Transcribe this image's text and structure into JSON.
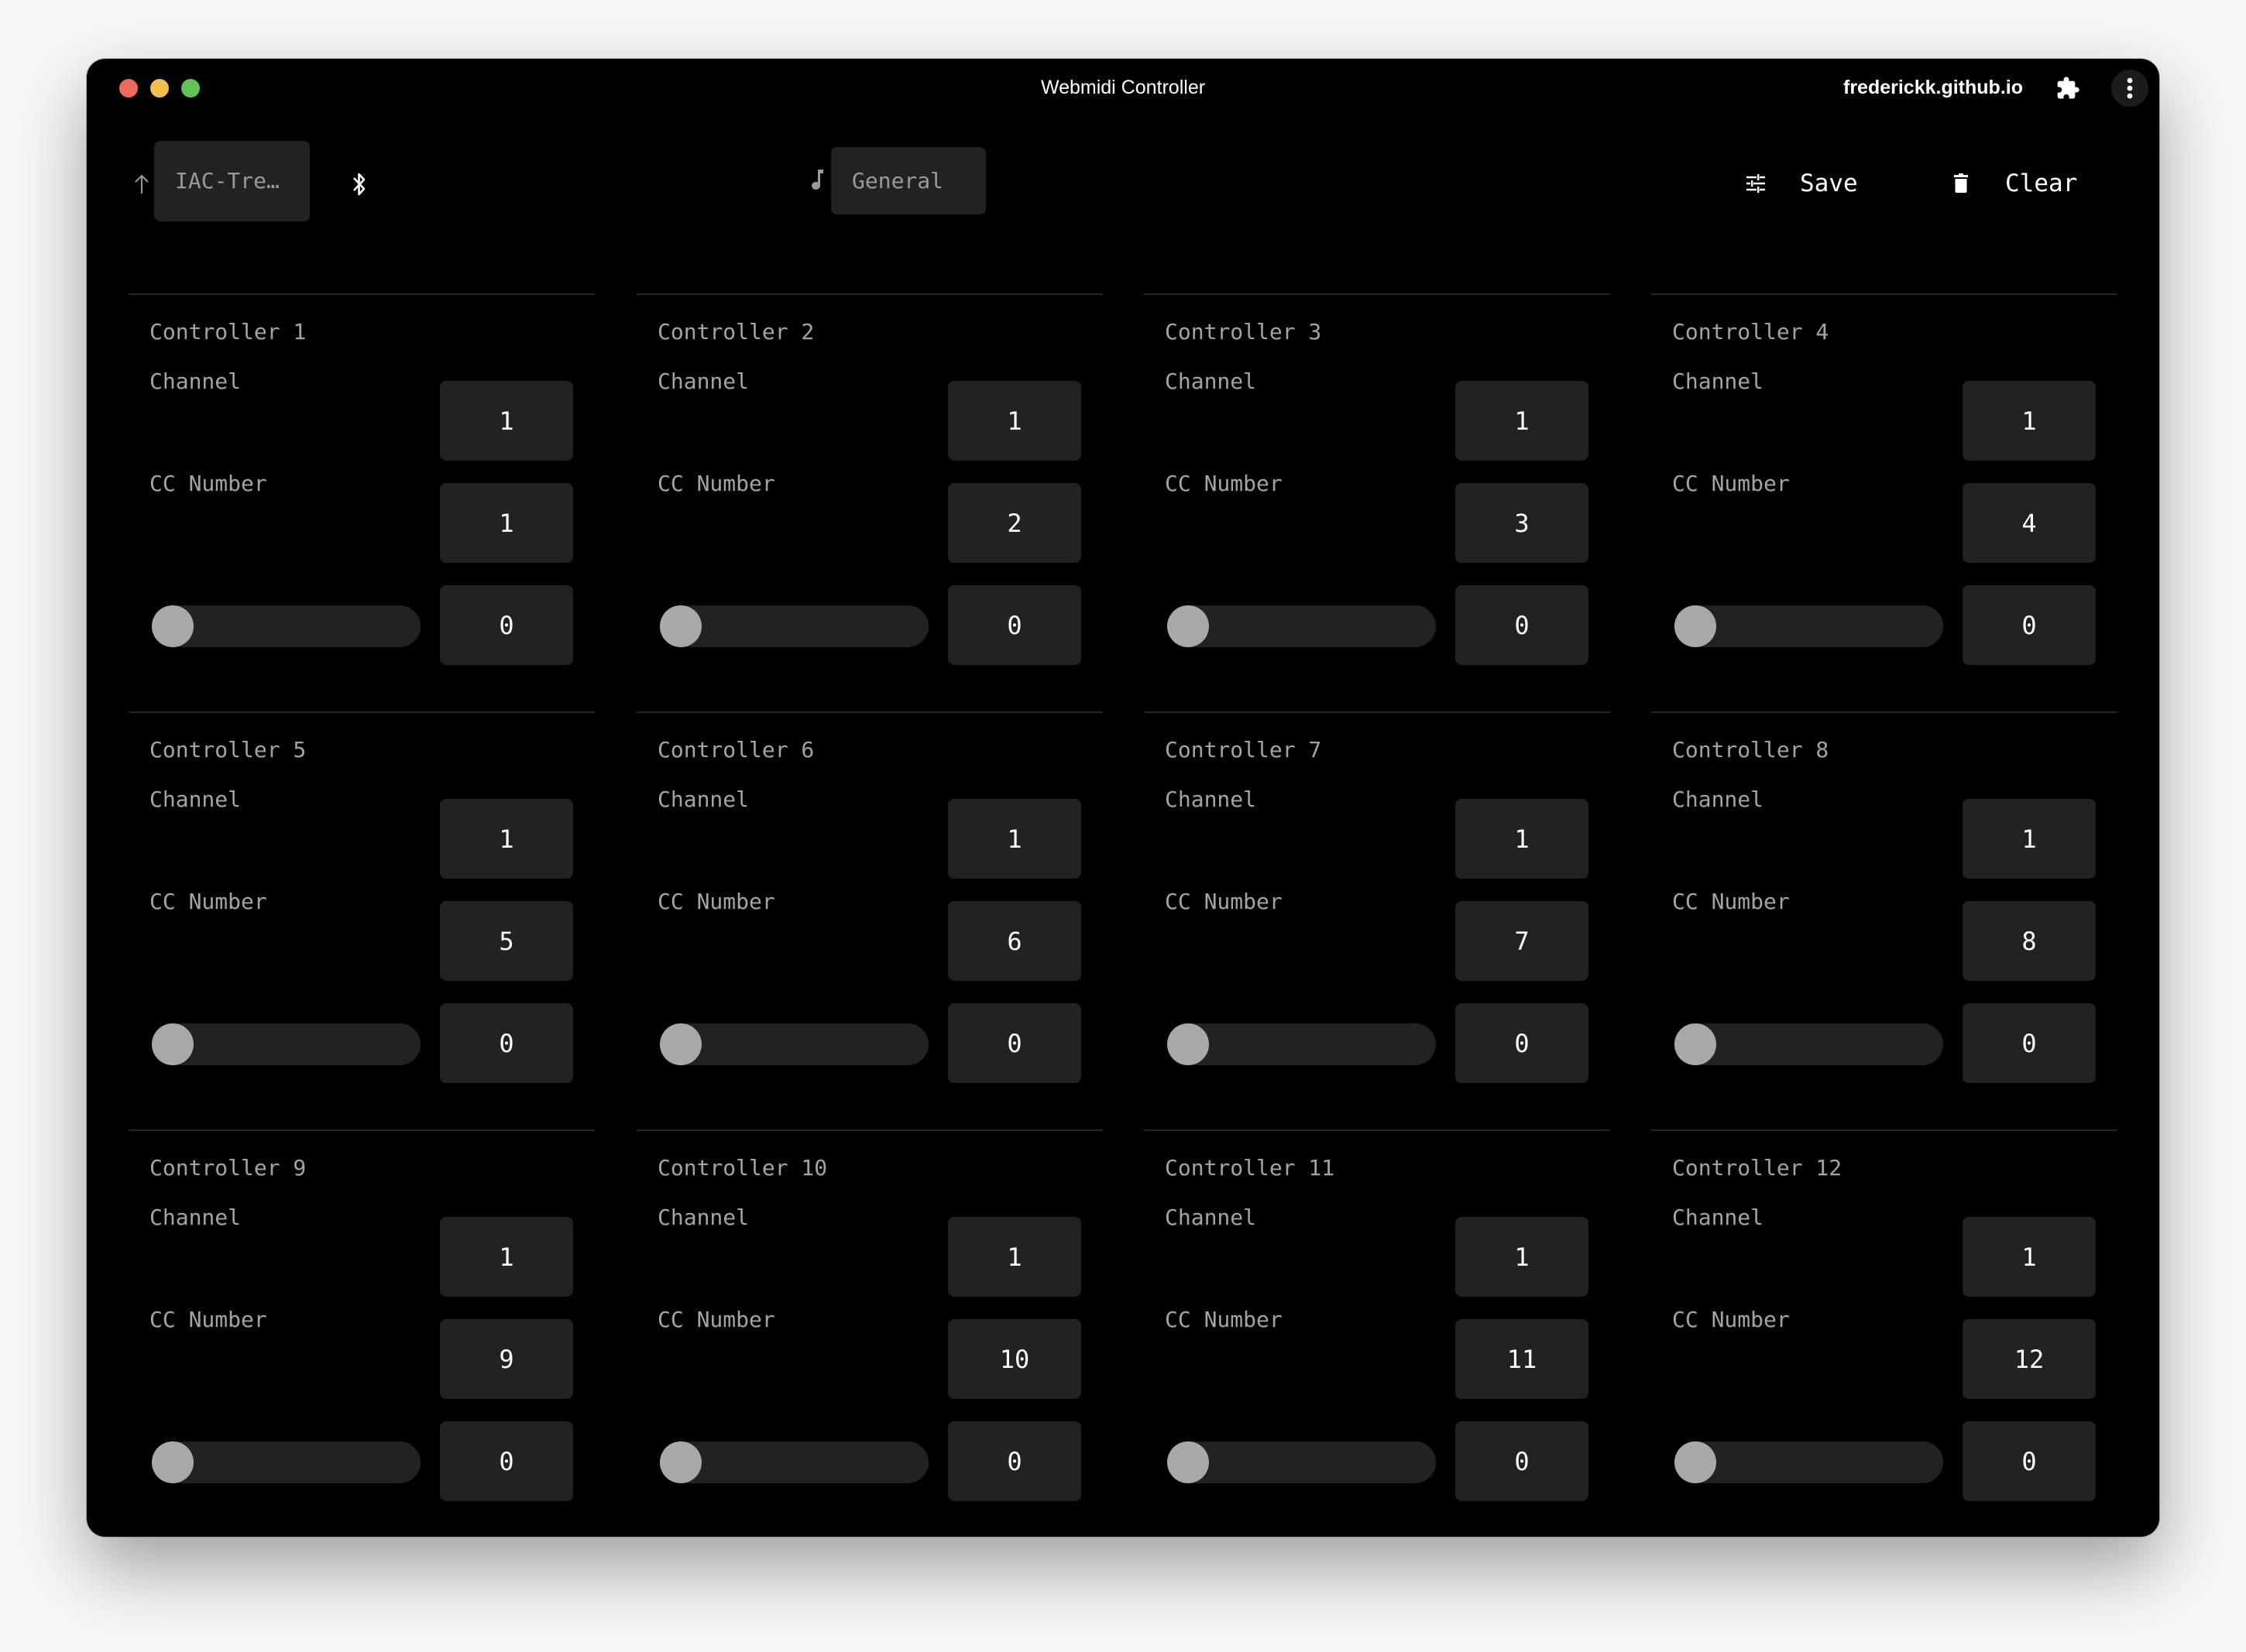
{
  "window": {
    "title": "Webmidi Controller",
    "domain": "frederickk.github.io",
    "traffic_lights": {
      "close": "#ee6a5f",
      "minimize": "#f5bf4f",
      "zoom": "#61c454"
    },
    "icons": {
      "extensions": "puzzle-icon",
      "menu": "more-vertical-icon"
    }
  },
  "toolbar": {
    "output_device": {
      "icon": "arrow-up-icon",
      "value": "IAC-Tre…"
    },
    "bluetooth": {
      "icon": "bluetooth-icon"
    },
    "instrument": {
      "icon": "music-note-icon",
      "value": "General"
    },
    "save": {
      "icon": "sliders-icon",
      "label": "Save"
    },
    "clear": {
      "icon": "trash-icon",
      "label": "Clear"
    }
  },
  "labels": {
    "channel": "Channel",
    "cc_number": "CC Number"
  },
  "controllers": [
    {
      "title": "Controller 1",
      "channel": "1",
      "cc": "1",
      "value": "0",
      "slider_fraction": 0
    },
    {
      "title": "Controller 2",
      "channel": "1",
      "cc": "2",
      "value": "0",
      "slider_fraction": 0
    },
    {
      "title": "Controller 3",
      "channel": "1",
      "cc": "3",
      "value": "0",
      "slider_fraction": 0
    },
    {
      "title": "Controller 4",
      "channel": "1",
      "cc": "4",
      "value": "0",
      "slider_fraction": 0
    },
    {
      "title": "Controller 5",
      "channel": "1",
      "cc": "5",
      "value": "0",
      "slider_fraction": 0
    },
    {
      "title": "Controller 6",
      "channel": "1",
      "cc": "6",
      "value": "0",
      "slider_fraction": 0
    },
    {
      "title": "Controller 7",
      "channel": "1",
      "cc": "7",
      "value": "0",
      "slider_fraction": 0
    },
    {
      "title": "Controller 8",
      "channel": "1",
      "cc": "8",
      "value": "0",
      "slider_fraction": 0
    },
    {
      "title": "Controller 9",
      "channel": "1",
      "cc": "9",
      "value": "0",
      "slider_fraction": 0
    },
    {
      "title": "Controller 10",
      "channel": "1",
      "cc": "10",
      "value": "0",
      "slider_fraction": 0
    },
    {
      "title": "Controller 11",
      "channel": "1",
      "cc": "11",
      "value": "0",
      "slider_fraction": 0
    },
    {
      "title": "Controller 12",
      "channel": "1",
      "cc": "12",
      "value": "0",
      "slider_fraction": 0
    }
  ],
  "colors": {
    "background": "#000000",
    "surface": "#222222",
    "label_text": "#a4a4a4",
    "value_text": "#ffffff",
    "slider_thumb": "#a8a8a8"
  }
}
